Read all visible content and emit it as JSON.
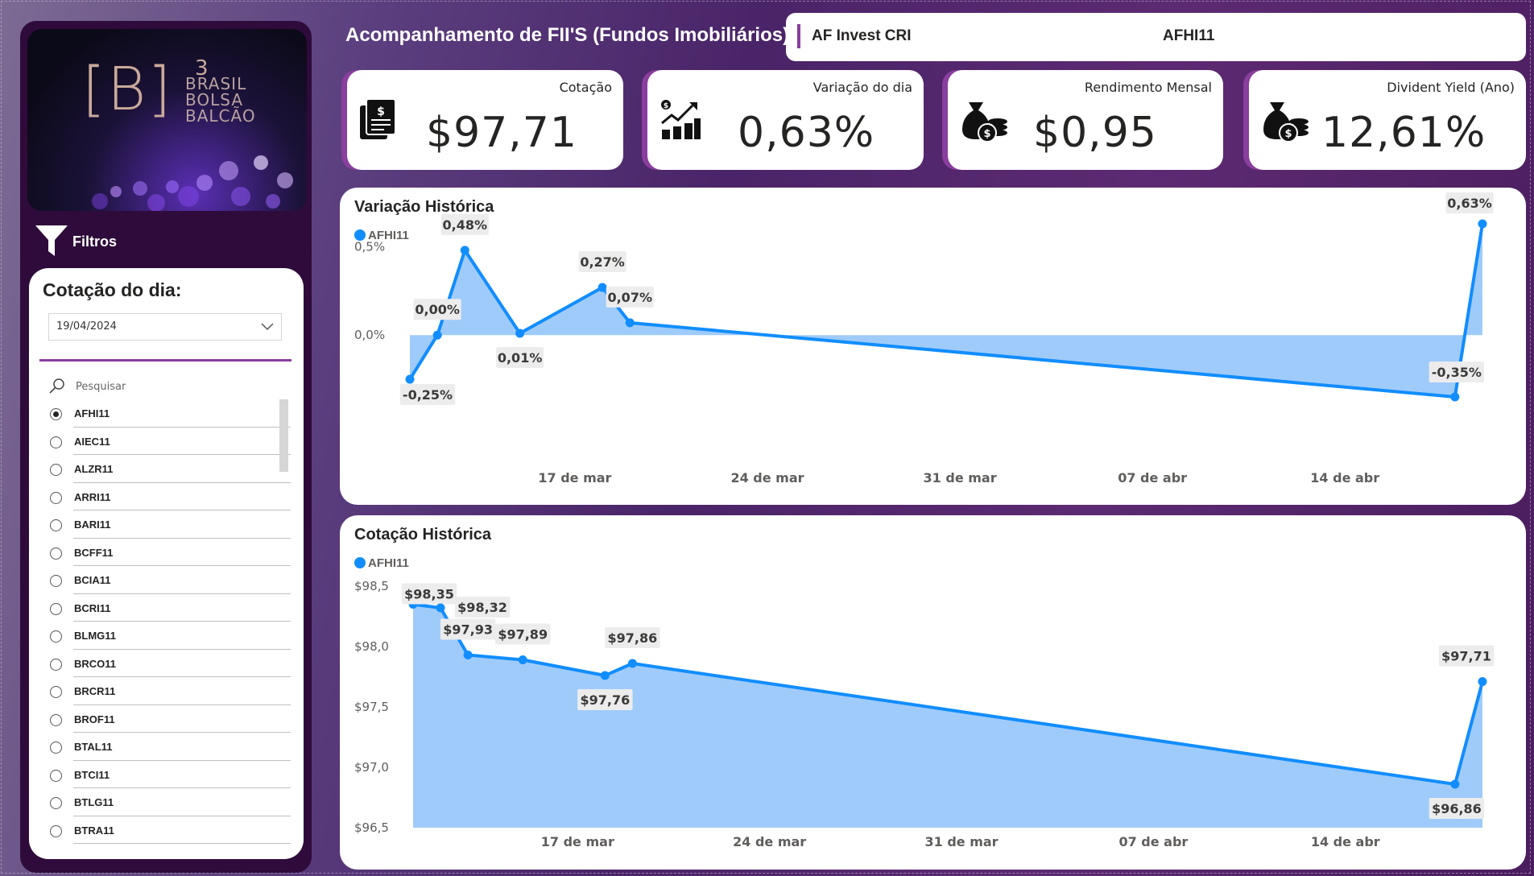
{
  "header": {
    "title": "Acompanhamento de FII'S (Fundos Imobiliários)",
    "fund_name": "AF Invest CRI",
    "fund_code": "AFHI11"
  },
  "logo": {
    "mark": "[B]",
    "superscript": "3",
    "lines": [
      "BRASIL",
      "BOLSA",
      "BALCÃO"
    ]
  },
  "sidebar": {
    "filters_label": "Filtros",
    "panel_title": "Cotação do dia:",
    "date_value": "19/04/2024",
    "search_placeholder": "Pesquisar",
    "tickers": [
      {
        "label": "AFHI11",
        "selected": true
      },
      {
        "label": "AIEC11",
        "selected": false
      },
      {
        "label": "ALZR11",
        "selected": false
      },
      {
        "label": "ARRI11",
        "selected": false
      },
      {
        "label": "BARI11",
        "selected": false
      },
      {
        "label": "BCFF11",
        "selected": false
      },
      {
        "label": "BCIA11",
        "selected": false
      },
      {
        "label": "BCRI11",
        "selected": false
      },
      {
        "label": "BLMG11",
        "selected": false
      },
      {
        "label": "BRCO11",
        "selected": false
      },
      {
        "label": "BRCR11",
        "selected": false
      },
      {
        "label": "BROF11",
        "selected": false
      },
      {
        "label": "BTAL11",
        "selected": false
      },
      {
        "label": "BTCI11",
        "selected": false
      },
      {
        "label": "BTLG11",
        "selected": false
      },
      {
        "label": "BTRA11",
        "selected": false
      }
    ]
  },
  "kpis": [
    {
      "label": "Cotação",
      "value": "$97,71",
      "icon": "document-dollar-icon"
    },
    {
      "label": "Variação do dia",
      "value": "0,63%",
      "icon": "growth-chart-icon"
    },
    {
      "label": "Rendimento Mensal",
      "value": "$0,95",
      "icon": "money-bag-icon"
    },
    {
      "label": "Divident Yield (Ano)",
      "value": "12,61%",
      "icon": "money-bag-icon"
    }
  ],
  "colors": {
    "accent": "#8a3e9d",
    "series": "#118dff",
    "area": "#9fcbfa"
  },
  "chart_data": [
    {
      "type": "area",
      "title": "Variação Histórica",
      "legend": [
        "AFHI11"
      ],
      "x_ticks": [
        "17 de mar",
        "24 de mar",
        "31 de mar",
        "07 de abr",
        "14 de abr"
      ],
      "y_ticks": [
        "0,0%",
        "0,5%"
      ],
      "series": [
        {
          "name": "AFHI11",
          "x": [
            "2024-03-11",
            "2024-03-12",
            "2024-03-13",
            "2024-03-15",
            "2024-03-18",
            "2024-03-19",
            "2024-04-18",
            "2024-04-19"
          ],
          "values": [
            -0.25,
            0.0,
            0.48,
            0.01,
            0.27,
            0.07,
            -0.35,
            0.63
          ],
          "labels": [
            "-0,25%",
            "0,00%",
            "0,48%",
            "0,01%",
            "0,27%",
            "0,07%",
            "-0,35%",
            "0,63%"
          ]
        }
      ]
    },
    {
      "type": "area",
      "title": "Cotação Histórica",
      "legend": [
        "AFHI11"
      ],
      "x_ticks": [
        "17 de mar",
        "24 de mar",
        "31 de mar",
        "07 de abr",
        "14 de abr"
      ],
      "y_ticks": [
        "$96,5",
        "$97,0",
        "$97,5",
        "$98,0",
        "$98,5"
      ],
      "series": [
        {
          "name": "AFHI11",
          "x": [
            "2024-03-11",
            "2024-03-12",
            "2024-03-13",
            "2024-03-15",
            "2024-03-18",
            "2024-03-19",
            "2024-04-18",
            "2024-04-19"
          ],
          "values": [
            98.35,
            98.32,
            97.93,
            97.89,
            97.76,
            97.86,
            96.86,
            97.71
          ],
          "labels": [
            "$98,35",
            "$98,32",
            "$97,93",
            "$97,89",
            "$97,76",
            "$97,86",
            "$96,86",
            "$97,71"
          ]
        }
      ]
    }
  ]
}
